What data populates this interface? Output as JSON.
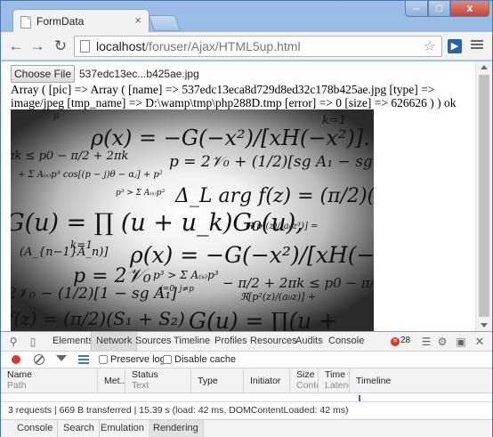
{
  "tab": {
    "title": "FormData",
    "close": "×"
  },
  "window": {
    "minimize": "–",
    "maximize": "□",
    "close": "x"
  },
  "toolbar": {
    "url_host": "localhost",
    "url_path": "/foruser/Ajax/HTML5up.html"
  },
  "page": {
    "choose_file_label": "Choose File",
    "file_name": "537edc13ec...b425ae.jpg",
    "print_r_output": "Array ( [pic] => Array ( [name] => 537edc13eca8d729d8ed32c178b425ae.jpg [type] => image/jpeg [tmp_name] => D:\\wamp\\tmp\\php288D.tmp [error] => 0 [size] => 626626 ) ) ok"
  },
  "devtools": {
    "tabs": [
      "Elements",
      "Network",
      "Sources",
      "Timeline",
      "Profiles",
      "Resources",
      "Audits",
      "Console"
    ],
    "active_tab": "Network",
    "error_count": "28",
    "preserve_log_label": "Preserve log",
    "disable_cache_label": "Disable cache",
    "columns": [
      {
        "title": "Name",
        "sub": "Path"
      },
      {
        "title": "Met...",
        "sub": ""
      },
      {
        "title": "Status",
        "sub": "Text"
      },
      {
        "title": "Type",
        "sub": ""
      },
      {
        "title": "Initiator",
        "sub": ""
      },
      {
        "title": "Size",
        "sub": "Conte"
      },
      {
        "title": "Time",
        "sub": "Latenc"
      },
      {
        "title": "Timeline",
        "sub": ""
      }
    ],
    "status_text": "3 requests | 669 B transferred | 15.39 s (load: 42 ms, DOMContentLoaded: 42 ms)",
    "drawer_tabs": [
      "Console",
      "Search",
      "Emulation",
      "Rendering"
    ],
    "active_drawer_tab": "Rendering"
  },
  "colors": {
    "accent": "#d8382f",
    "chrome_frame": "#7aa7da",
    "timeline_bar": "#4a5fd6"
  }
}
